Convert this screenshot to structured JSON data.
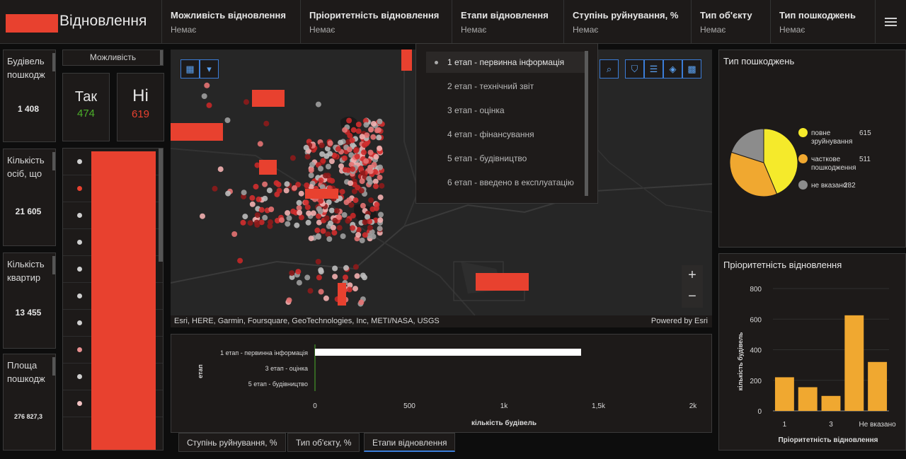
{
  "header": {
    "title": "Відновлення",
    "filters": [
      {
        "label": "Можливість відновлення",
        "value": "Немає"
      },
      {
        "label": "Пріоритетність відновлення",
        "value": "Немає"
      },
      {
        "label": "Етапи відновлення",
        "value": "Немає"
      },
      {
        "label": "Ступінь руйнування, %",
        "value": "Немає"
      },
      {
        "label": "Тип об'єкту",
        "value": "Немає"
      },
      {
        "label": "Тип пошкоджень",
        "value": "Немає"
      }
    ]
  },
  "stats": [
    {
      "title": "Будівель пошкодж",
      "value": "1 408"
    },
    {
      "title": "Кількість осіб, що",
      "value": "21 605"
    },
    {
      "title": "Кількість квартир",
      "value": "13 455"
    },
    {
      "title": "Площа пошкодж",
      "value": "276 827,3"
    }
  ],
  "possibility": {
    "header": "Можливість",
    "yes_label": "Так",
    "yes_count": "474",
    "no_label": "Ні",
    "no_count": "619"
  },
  "dot_list": [
    "#cfcfcf",
    "#e8412f",
    "#cfcfcf",
    "#cfcfcf",
    "#cfcfcf",
    "#cfcfcf",
    "#cfcfcf",
    "#e89090",
    "#cfcfcf",
    "#f2c2c2"
  ],
  "stage_dropdown": {
    "items": [
      "1 етап - первинна інформація",
      "2 етап - технічний звіт",
      "3 етап - оцінка",
      "4 етап - фінансування",
      "5 етап - будівництво",
      "6 етап - введено в експлуатацію"
    ],
    "selected_index": 0
  },
  "map": {
    "attribution": "Esri, HERE, Garmin, Foursquare, GeoTechnologies, Inc, METI/NASA, USGS",
    "powered_by": "Powered by Esri",
    "zoom_in": "+",
    "zoom_out": "−"
  },
  "tabs": [
    {
      "label": "Ступінь руйнування, %",
      "active": false
    },
    {
      "label": "Тип об'єкту, %",
      "active": false
    },
    {
      "label": "Етапи відновлення",
      "active": true
    }
  ],
  "colors": {
    "accent": "#3b7dd8",
    "redaction": "#e8412f",
    "yes": "#4caf2a",
    "no": "#e8412f",
    "bar": "#f0a830"
  },
  "chart_data": [
    {
      "type": "bar",
      "orientation": "horizontal",
      "categories": [
        "1 етап - первинна інформація",
        "3 етап - оцінка",
        "5 етап - будівництво"
      ],
      "values": [
        1408,
        0,
        0
      ],
      "xlabel": "кількість будівель",
      "ylabel": "етап",
      "xlim": [
        0,
        2000
      ],
      "xticks": [
        "0",
        "500",
        "1k",
        "1,5k",
        "2k"
      ],
      "color": "#ffffff"
    },
    {
      "type": "pie",
      "title": "Тип пошкоджень",
      "slices": [
        {
          "label": "повне зруйнування",
          "value": 615,
          "color": "#f5ea2b"
        },
        {
          "label": "часткове пошкодження",
          "value": 511,
          "color": "#f0a830"
        },
        {
          "label": "не вказано",
          "value": 282,
          "color": "#8c8c8c"
        }
      ]
    },
    {
      "type": "bar",
      "title": "Пріоритетність відновлення",
      "categories": [
        "1",
        "2",
        "3",
        "4",
        "Не вказано"
      ],
      "visible_tick_labels": [
        "1",
        "3",
        "Не вказано"
      ],
      "values": [
        220,
        155,
        98,
        625,
        320
      ],
      "xlabel": "Пріоритетність відновлення",
      "ylabel": "кількість будівель",
      "ylim": [
        0,
        800
      ],
      "yticks": [
        "0",
        "200",
        "400",
        "600",
        "800"
      ],
      "color": "#f0a830"
    }
  ]
}
